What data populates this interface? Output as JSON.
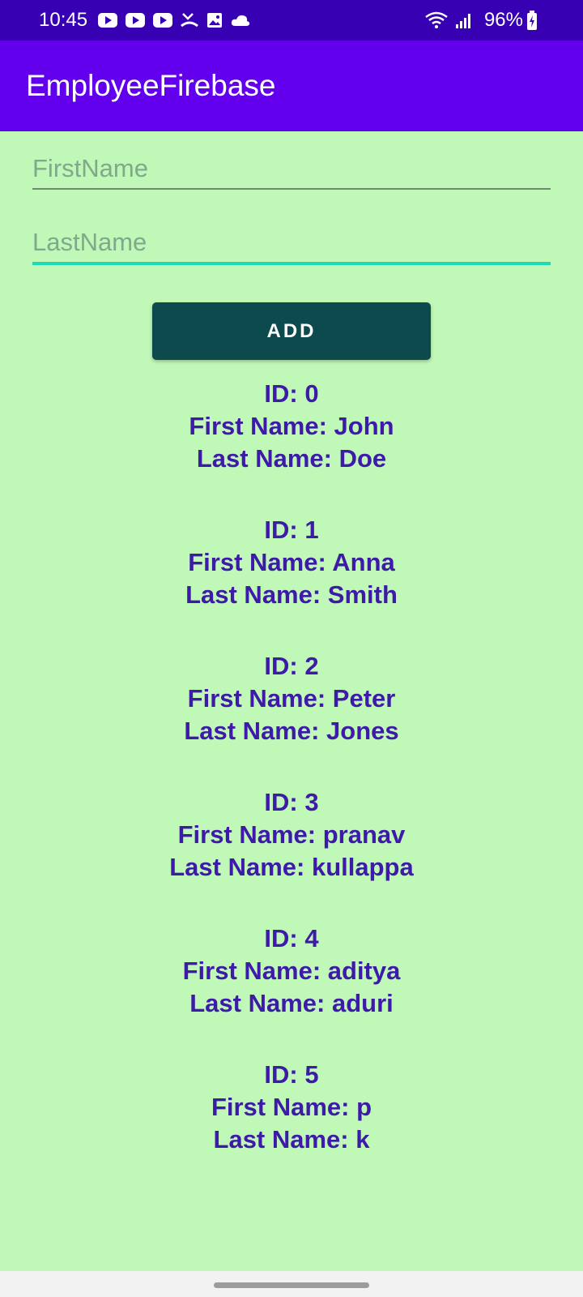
{
  "status_bar": {
    "time": "10:45",
    "battery": "96%",
    "icons": [
      "youtube-icon",
      "youtube-icon",
      "youtube-icon",
      "missed-call-icon",
      "gallery-icon",
      "cloud-icon",
      "wifi-icon",
      "signal-icon",
      "battery-charging-icon"
    ]
  },
  "app_bar": {
    "title": "EmployeeFirebase"
  },
  "form": {
    "first_name_placeholder": "FirstName",
    "first_name_value": "",
    "last_name_placeholder": "LastName",
    "last_name_value": "",
    "add_label": "ADD"
  },
  "employees": [
    {
      "id_text": "ID: 0",
      "first_text": "First Name: John",
      "last_text": "Last Name: Doe"
    },
    {
      "id_text": "ID: 1",
      "first_text": "First Name: Anna",
      "last_text": "Last Name: Smith"
    },
    {
      "id_text": "ID: 2",
      "first_text": "First Name: Peter",
      "last_text": "Last Name: Jones"
    },
    {
      "id_text": "ID: 3",
      "first_text": "First Name: pranav",
      "last_text": "Last Name: kullappa"
    },
    {
      "id_text": "ID: 4",
      "first_text": "First Name: aditya",
      "last_text": "Last Name: aduri"
    },
    {
      "id_text": "ID: 5",
      "first_text": "First Name: p",
      "last_text": "Last Name: k"
    }
  ],
  "colors": {
    "status_bar": "#3700b3",
    "app_bar": "#6200ee",
    "background": "#c0f8b8",
    "button": "#0d4a4e",
    "list_text": "#3d1aa8",
    "focus_underline": "#1fd8b6"
  }
}
